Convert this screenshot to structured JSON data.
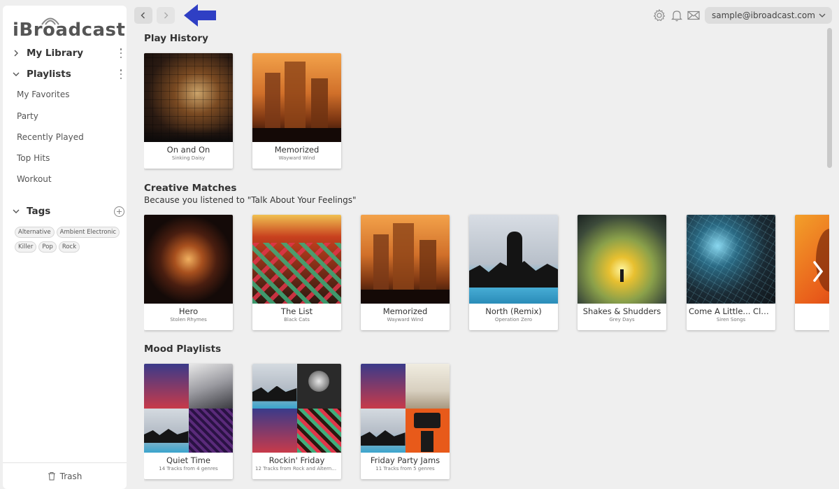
{
  "brand": {
    "name": "iBroadcast"
  },
  "sidebar": {
    "library": {
      "label": "My Library"
    },
    "playlists": {
      "label": "Playlists",
      "items": [
        "My Favorites",
        "Party",
        "Recently Played",
        "Top Hits",
        "Workout"
      ]
    },
    "tags": {
      "label": "Tags",
      "items": [
        "Alternative",
        "Ambient Electronic",
        "Killer",
        "Pop",
        "Rock"
      ]
    },
    "trash": {
      "label": "Trash"
    }
  },
  "header": {
    "account": "sample@ibroadcast.com"
  },
  "play_history": {
    "title": "Play History",
    "cards": [
      {
        "title": "On and On",
        "subtitle": "Sinking Daisy"
      },
      {
        "title": "Memorized",
        "subtitle": "Wayward Wind"
      }
    ]
  },
  "creative_matches": {
    "title": "Creative Matches",
    "subtitle": "Because you listened to \"Talk About Your Feelings\"",
    "cards": [
      {
        "title": "Hero",
        "subtitle": "Stolen Rhymes"
      },
      {
        "title": "The List",
        "subtitle": "Black Cats"
      },
      {
        "title": "Memorized",
        "subtitle": "Wayward Wind"
      },
      {
        "title": "North (Remix)",
        "subtitle": "Operation Zero"
      },
      {
        "title": "Shakes & Shudders",
        "subtitle": "Grey Days"
      },
      {
        "title": "Come A Little... Clos...",
        "subtitle": "Siren Songs"
      }
    ]
  },
  "mood_playlists": {
    "title": "Mood Playlists",
    "cards": [
      {
        "title": "Quiet Time",
        "subtitle": "14 Tracks from 4 genres"
      },
      {
        "title": "Rockin' Friday",
        "subtitle": "12 Tracks from Rock and Alterna..."
      },
      {
        "title": "Friday Party Jams",
        "subtitle": "11 Tracks from 5 genres"
      }
    ]
  },
  "colors": {
    "accent_arrow": "#2f3fc4",
    "sidebar_bg": "#ffffff",
    "page_bg": "#efefef"
  }
}
